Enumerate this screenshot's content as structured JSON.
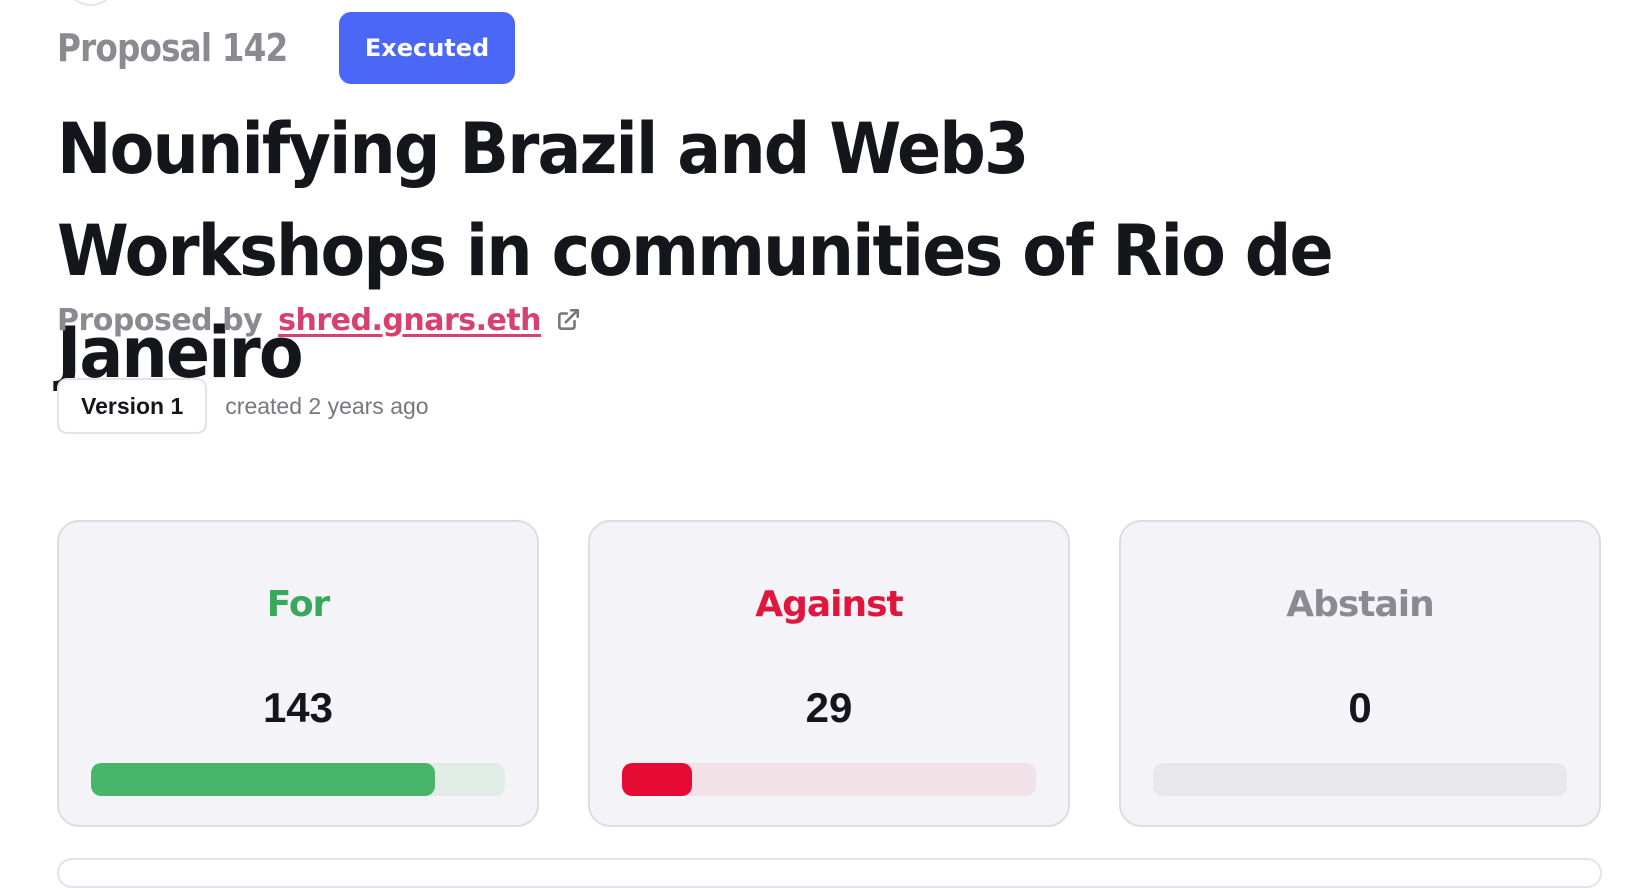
{
  "proposal": {
    "number_label": "Proposal 142",
    "status": "Executed",
    "status_color": "#4a68f5",
    "title": "Nounifying Brazil and Web3 Workshops in communities of Rio de Janeiro",
    "proposed_by_label": "Proposed by",
    "proposer": "shred.gnars.eth"
  },
  "version": {
    "label": "Version 1",
    "created": "created 2 years ago"
  },
  "votes": [
    {
      "key": "for",
      "label": "For",
      "count": "143",
      "fraction": 0.8315,
      "label_color": "#3aa85a",
      "fill_color": "#48b56a",
      "track_color": "#e1ece7"
    },
    {
      "key": "against",
      "label": "Against",
      "count": "29",
      "fraction": 0.1686,
      "label_color": "#e0173d",
      "fill_color": "#e50b35",
      "track_color": "#f2e2e8"
    },
    {
      "key": "abstain",
      "label": "Abstain",
      "count": "0",
      "fraction": 0,
      "label_color": "#8a8a90",
      "fill_color": "#b8b8c0",
      "track_color": "#e7e7ec"
    }
  ]
}
